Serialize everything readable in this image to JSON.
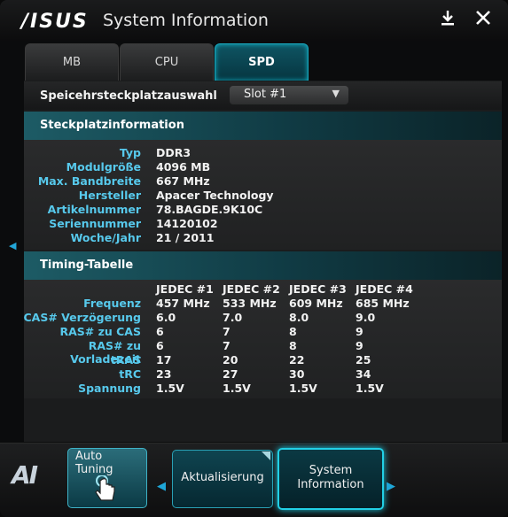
{
  "window": {
    "logo": "/ISUS",
    "title": "System Information",
    "download_icon": "download-icon",
    "close_icon": "close-icon"
  },
  "tabs": [
    {
      "label": "MB",
      "active": false
    },
    {
      "label": "CPU",
      "active": false
    },
    {
      "label": "SPD",
      "active": true
    }
  ],
  "slot_selector": {
    "label": "Speicehrsteckplatzauswahl",
    "value": "Slot #1"
  },
  "slot_info": {
    "heading": "Steckplatzinformation",
    "rows": [
      {
        "label": "Typ",
        "value": "DDR3"
      },
      {
        "label": "Modulgröße",
        "value": "4096 MB"
      },
      {
        "label": "Max. Bandbreite",
        "value": "667 MHz"
      },
      {
        "label": "Hersteller",
        "value": "Apacer Technology"
      },
      {
        "label": "Artikelnummer",
        "value": "78.BAGDE.9K10C"
      },
      {
        "label": "Seriennummer",
        "value": "14120102"
      },
      {
        "label": "Woche/Jahr",
        "value": "21 / 2011"
      }
    ]
  },
  "timing": {
    "heading": "Timing-Tabelle",
    "columns": [
      "JEDEC #1",
      "JEDEC #2",
      "JEDEC #3",
      "JEDEC #4"
    ],
    "rows": [
      {
        "label": "Frequenz",
        "values": [
          "457 MHz",
          "533 MHz",
          "609 MHz",
          "685 MHz"
        ]
      },
      {
        "label": "CAS# Verzögerung",
        "values": [
          "6.0",
          "7.0",
          "8.0",
          "9.0"
        ]
      },
      {
        "label": "RAS# zu CAS",
        "values": [
          "6",
          "7",
          "8",
          "9"
        ]
      },
      {
        "label": "RAS# zu Vorladezeit",
        "values": [
          "6",
          "7",
          "8",
          "9"
        ]
      },
      {
        "label": "tRAS",
        "values": [
          "17",
          "20",
          "22",
          "25"
        ]
      },
      {
        "label": "tRC",
        "values": [
          "23",
          "27",
          "30",
          "34"
        ]
      },
      {
        "label": "Spannung",
        "values": [
          "1.5V",
          "1.5V",
          "1.5V",
          "1.5V"
        ]
      }
    ]
  },
  "bottom": {
    "ai_logo": "AI",
    "auto_tuning_line1": "Auto",
    "auto_tuning_line2": "Tuning",
    "refresh_label": "Aktualisierung",
    "sysinfo_line1": "System",
    "sysinfo_line2": "Information"
  },
  "colors": {
    "accent": "#22d0e6",
    "label_blue": "#57c9ec",
    "header_teal": "#1d5b65"
  }
}
